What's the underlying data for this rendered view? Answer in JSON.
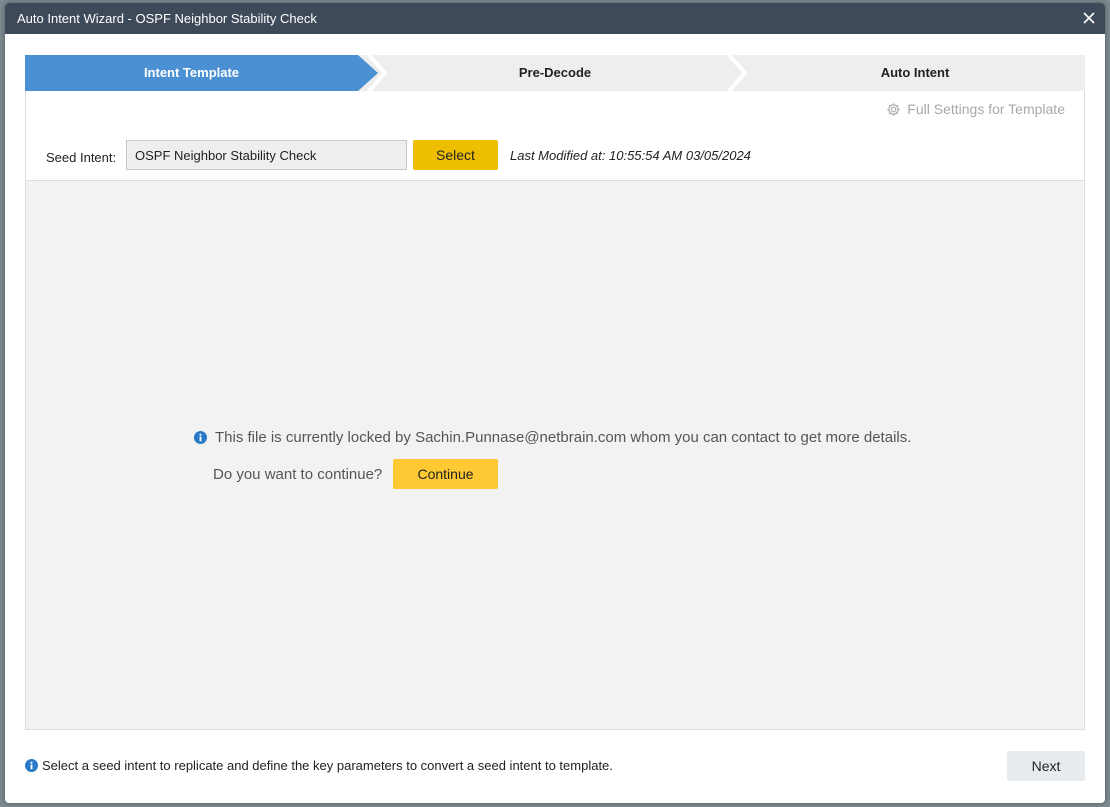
{
  "window": {
    "title": "Auto Intent Wizard - OSPF Neighbor Stability Check"
  },
  "steps": [
    {
      "label": "Intent Template",
      "active": true
    },
    {
      "label": "Pre-Decode",
      "active": false
    },
    {
      "label": "Auto Intent",
      "active": false
    }
  ],
  "settings_link": "Full Settings for Template",
  "seed": {
    "label": "Seed Intent:",
    "value": "OSPF Neighbor Stability Check",
    "select_label": "Select",
    "modified": "Last Modified at: 10:55:54 AM 03/05/2024"
  },
  "lock": {
    "message": "This file is currently locked by Sachin.Punnase@netbrain.com whom you can contact to get more details.",
    "question": "Do you want to continue?",
    "continue_label": "Continue"
  },
  "footer": {
    "hint": "Select a seed intent to replicate and define the key parameters to convert a seed intent to template.",
    "next_label": "Next"
  },
  "colors": {
    "titlebar": "#3e4a59",
    "active_step": "#4a90d2",
    "select_button": "#eebe00",
    "continue_button": "#ffc933",
    "info": "#2a78c8"
  }
}
